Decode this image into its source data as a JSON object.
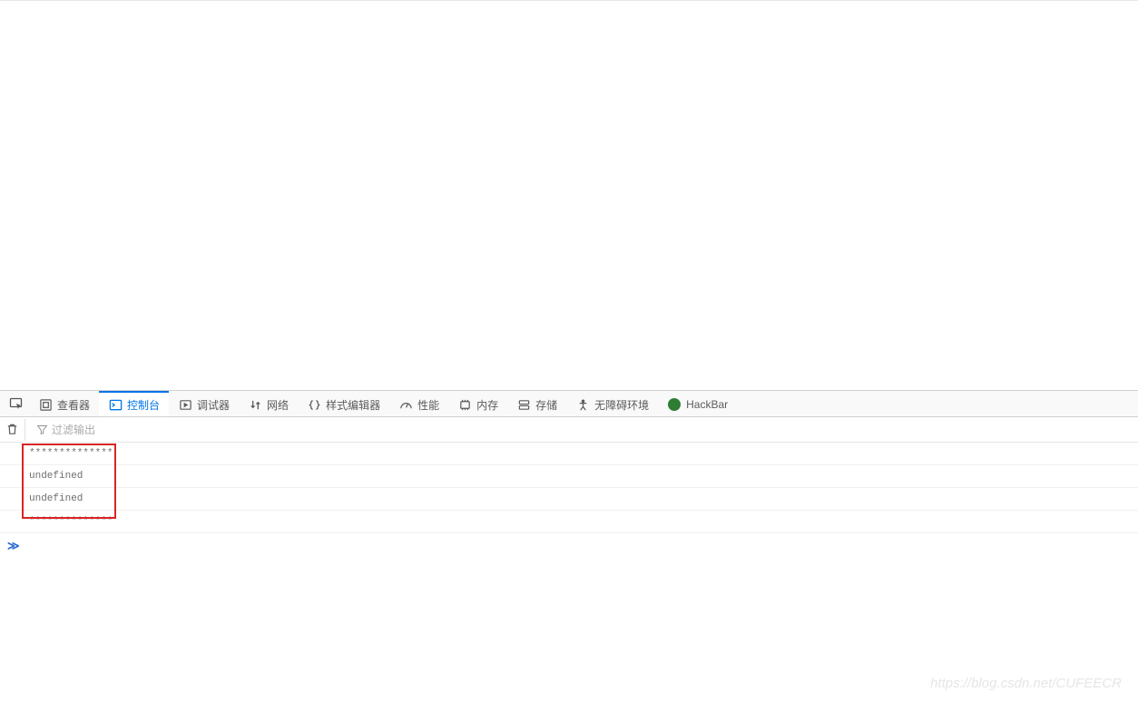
{
  "toolbar": {
    "tabs": [
      {
        "id": "inspector",
        "label": "查看器"
      },
      {
        "id": "console",
        "label": "控制台"
      },
      {
        "id": "debugger",
        "label": "调试器"
      },
      {
        "id": "network",
        "label": "网络"
      },
      {
        "id": "styleeditor",
        "label": "样式编辑器"
      },
      {
        "id": "performance",
        "label": "性能"
      },
      {
        "id": "memory",
        "label": "内存"
      },
      {
        "id": "storage",
        "label": "存储"
      },
      {
        "id": "accessibility",
        "label": "无障碍环境"
      },
      {
        "id": "hackbar",
        "label": "HackBar"
      }
    ],
    "active_tab": "console"
  },
  "filter": {
    "placeholder": "过滤输出"
  },
  "console": {
    "rows": [
      "**************",
      "undefined",
      "undefined",
      "**************"
    ],
    "prompt": "≫"
  },
  "watermark": "https://blog.csdn.net/CUFEECR"
}
